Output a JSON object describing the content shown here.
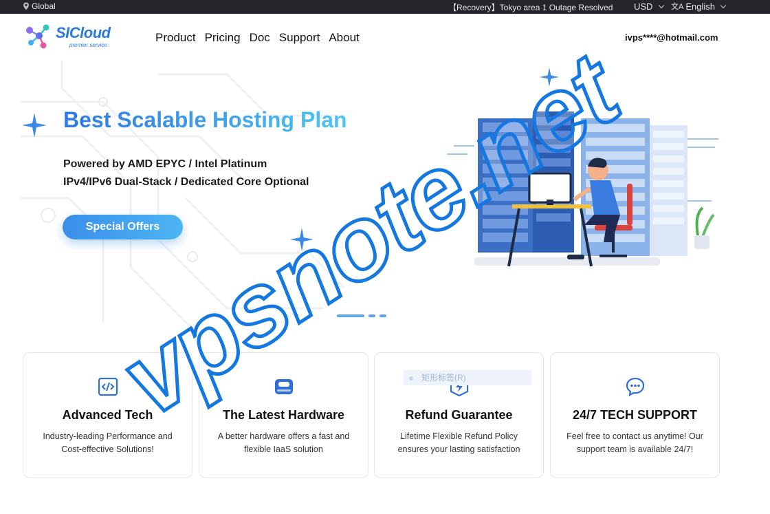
{
  "topbar": {
    "region": "Global",
    "notice": "【Recovery】Tokyo area 1 Outage Resolved",
    "currency": "USD",
    "language": "English"
  },
  "header": {
    "logo_text": "SICloud",
    "logo_tagline": "premier service",
    "nav": [
      "Product",
      "Pricing",
      "Doc",
      "Support",
      "About"
    ],
    "account": "ivps****@hotmail.com"
  },
  "hero": {
    "title": "Best Scalable Hosting Plan",
    "line1": "Powered by AMD EPYC / Intel Platinum",
    "line2": "IPv4/IPv6 Dual-Stack / Dedicated Core Optional",
    "cta": "Special Offers",
    "carousel_slide": 1,
    "carousel_total": 3
  },
  "watermark": "vpsnote.net",
  "ghost_label": "矩形标签(R)",
  "features": [
    {
      "icon": "code-icon",
      "title": "Advanced Tech",
      "desc": "Industry-leading Performance and Cost-effective Solutions!"
    },
    {
      "icon": "hard-drive-icon",
      "title": "The Latest Hardware",
      "desc": "A better hardware offers a fast and flexible IaaS solution"
    },
    {
      "icon": "lightning-shield-icon",
      "title": "Refund Guarantee",
      "desc": "Lifetime Flexible Refund Policy ensures your lasting satisfaction"
    },
    {
      "icon": "chat-bubble-icon",
      "title": "24/7 TECH SUPPORT",
      "desc": "Feel free to contact us anytime! Our support team is available 24/7!"
    }
  ],
  "colors": {
    "topbar_bg": "#23252b",
    "accent": "#3a8ee9",
    "title_gradient_start": "#2f79e6",
    "title_gradient_end": "#4cc8f2"
  }
}
